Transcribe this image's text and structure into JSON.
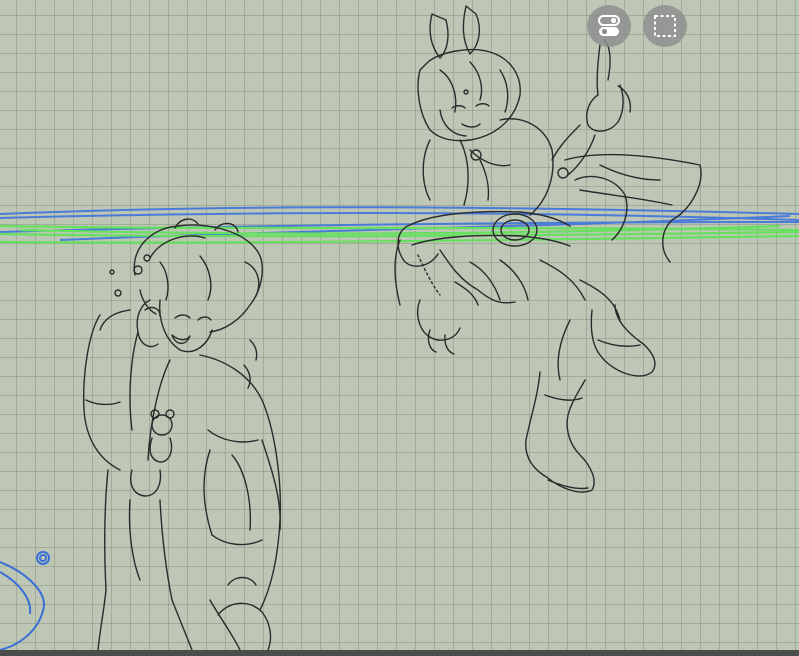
{
  "app": {
    "view": "drawing-canvas"
  },
  "toolbar": {
    "buttons": [
      {
        "id": "toggle",
        "icon": "toggle-switch-icon"
      },
      {
        "id": "selection",
        "icon": "dashed-selection-icon"
      }
    ]
  },
  "canvas": {
    "grid": true,
    "background_color": "#bec7b6",
    "line_color": "#2b2b2b",
    "stroke_colors": [
      "#4a7bd8",
      "#5fe05a"
    ]
  }
}
